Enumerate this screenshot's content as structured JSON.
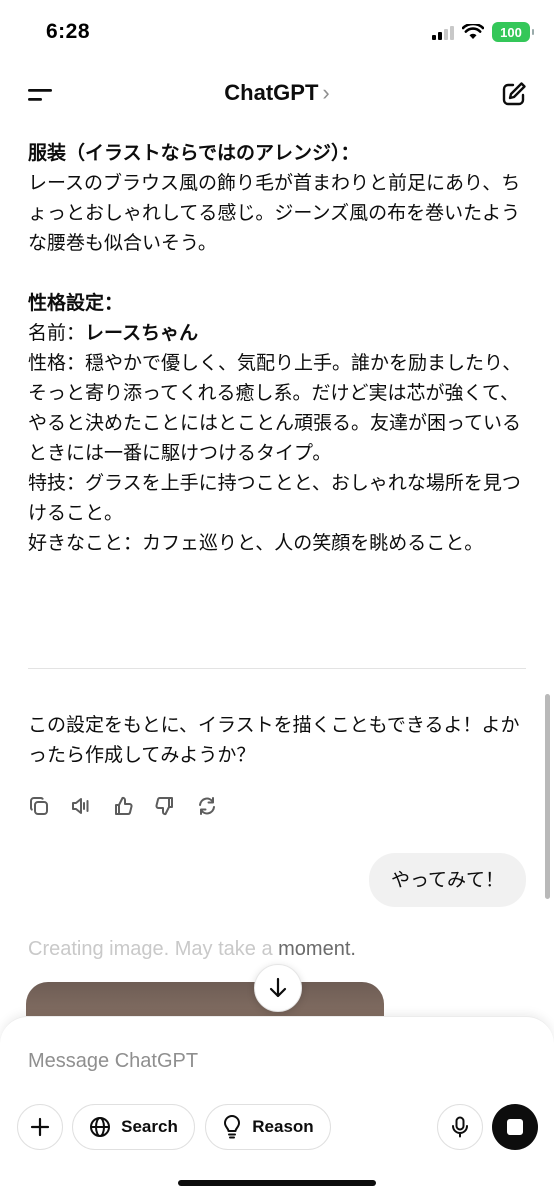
{
  "status_bar": {
    "time": "6:28",
    "battery": "100"
  },
  "header": {
    "title": "ChatGPT",
    "title_chevron": "›"
  },
  "assistant_message": {
    "outfit_heading": "服装（イラストならではのアレンジ）：",
    "outfit_text": "レースのブラウス風の飾り毛が首まわりと前足にあり、ちょっとおしゃれしてる感じ。ジーンズ風の布を巻いたような腰巻も似合いそう。",
    "personality_heading": "性格設定：",
    "name_label": "名前：",
    "name_value": "レースちゃん",
    "personality_text": "性格：穏やかで優しく、気配り上手。誰かを励ましたり、そっと寄り添ってくれる癒し系。だけど実は芯が強くて、やると決めたことにはとことん頑張る。友達が困っているときには一番に駆けつけるタイプ。",
    "skill_text": "特技：グラスを上手に持つことと、おしゃれな場所を見つけること。",
    "likes_text": "好きなこと：カフェ巡りと、人の笑顔を眺めること。",
    "followup_text": "この設定をもとに、イラストを描くこともできるよ！よかったら作成してみようか？"
  },
  "action_icons": [
    "copy-icon",
    "read-aloud-icon",
    "thumbs-up-icon",
    "thumbs-down-icon",
    "regenerate-icon"
  ],
  "user_message": "やってみて！",
  "creating_status": {
    "faded": "Creating image. May take a ",
    "highlight": "moment."
  },
  "composer": {
    "placeholder": "Message ChatGPT",
    "search_label": "Search",
    "reason_label": "Reason"
  },
  "colors": {
    "battery": "#34c759",
    "stop_button": "#0d0d0d",
    "user_bubble": "#f1f1f1"
  }
}
